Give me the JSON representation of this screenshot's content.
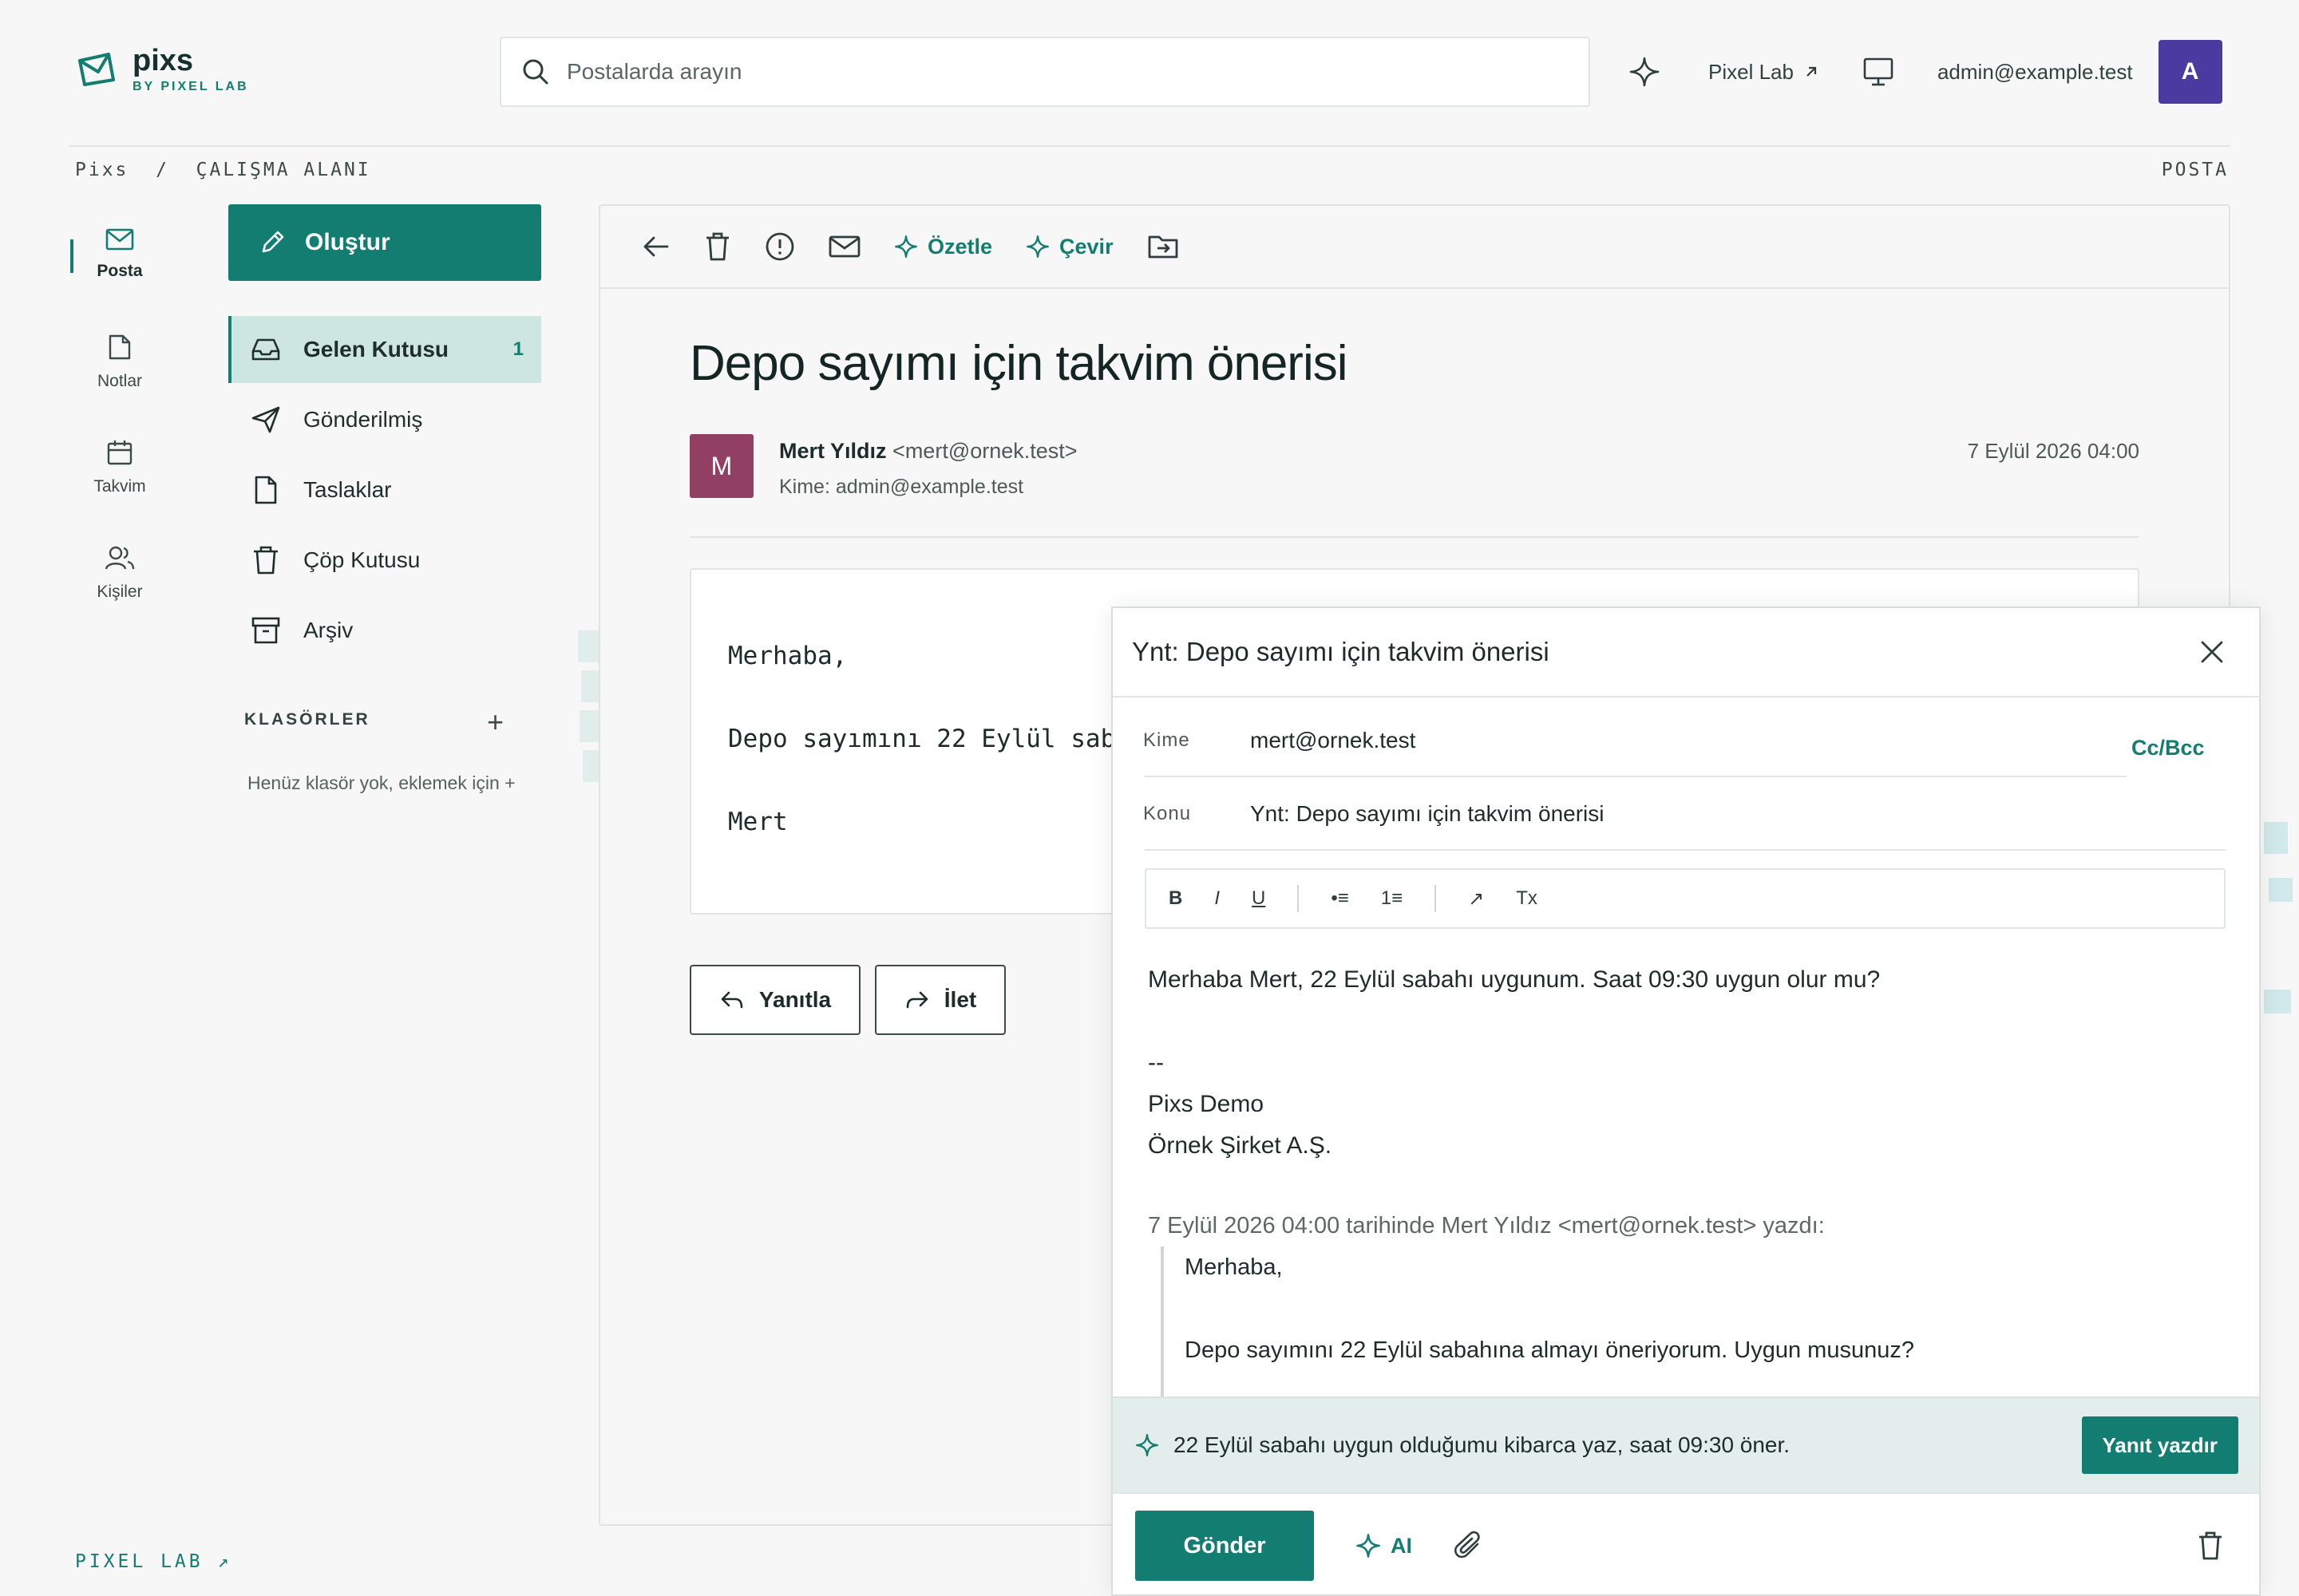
{
  "app": {
    "name": "pixs",
    "by": "BY PIXEL LAB"
  },
  "search": {
    "placeholder": "Postalarda arayın"
  },
  "header": {
    "pixel_lab_link": "Pixel Lab",
    "user_email": "admin@example.test",
    "avatar_letter": "A"
  },
  "breadcrumb": {
    "path": "Pixs  /  ÇALIŞMA ALANI",
    "section": "POSTA"
  },
  "rail": {
    "items": [
      {
        "label": "Posta",
        "icon": "mail-icon"
      },
      {
        "label": "Notlar",
        "icon": "note-icon"
      },
      {
        "label": "Takvim",
        "icon": "calendar-icon"
      },
      {
        "label": "Kişiler",
        "icon": "contacts-icon"
      }
    ]
  },
  "sidebar": {
    "compose_label": "Oluştur",
    "items": [
      {
        "label": "Gelen Kutusu",
        "count": "1",
        "icon": "inbox-icon"
      },
      {
        "label": "Gönderilmiş",
        "icon": "send-icon"
      },
      {
        "label": "Taslaklar",
        "icon": "draft-icon"
      },
      {
        "label": "Çöp Kutusu",
        "icon": "trash-icon"
      },
      {
        "label": "Arşiv",
        "icon": "archive-icon"
      }
    ],
    "folders_title": "KLASÖRLER",
    "folders_add": "+",
    "folders_empty": "Henüz klasör yok, eklemek için +"
  },
  "footer": {
    "brand": "PIXEL LAB ↗"
  },
  "toolbar": {
    "summarize": "Özetle",
    "translate": "Çevir"
  },
  "mail": {
    "subject": "Depo sayımı için takvim önerisi",
    "sender_initial": "M",
    "sender_name": "Mert Yıldız",
    "sender_email": "<mert@ornek.test>",
    "to_line": "Kime: admin@example.test",
    "date": "7 Eylül 2026 04:00",
    "body": "Merhaba,\n\nDepo sayımını 22 Eylül sabahına almayı öneriyorum. Uygun musunuz?\n\nMert",
    "reply_label": "Yanıtla",
    "forward_label": "İlet"
  },
  "composer": {
    "title": "Ynt: Depo sayımı için takvim önerisi",
    "to_label": "Kime",
    "to_value": "mert@ornek.test",
    "cc_bcc": "Cc/Bcc",
    "subject_label": "Konu",
    "subject_value": "Ynt: Depo sayımı için takvim önerisi",
    "rte": {
      "bold": "B",
      "italic": "I",
      "underline": "U",
      "bullets": "•≡",
      "numbers": "1≡",
      "link": "↗",
      "clear": "Tx"
    },
    "body_line1": "Merhaba Mert, 22 Eylül sabahı uygunum. Saat 09:30 uygun olur mu?",
    "signature_sep": "--",
    "signature_name": "Pixs Demo",
    "signature_company": "Örnek Şirket A.Ş.",
    "quote_header": "7 Eylül 2026 04:00 tarihinde Mert Yıldız <mert@ornek.test> yazdı:",
    "quote_line1": "Merhaba,",
    "quote_line2": "Depo sayımını 22 Eylül sabahına almayı öneriyorum. Uygun musunuz?",
    "ai_prompt": "22 Eylül sabahı uygun olduğumu kibarca yaz, saat 09:30 öner.",
    "ai_button": "Yanıt yazdır",
    "send_label": "Gönder",
    "ai_label": "AI"
  },
  "colors": {
    "accent": "#127d70",
    "avatar_user": "#4b3aa0",
    "avatar_sender": "#923f64",
    "active_bg": "#cde6e1"
  }
}
